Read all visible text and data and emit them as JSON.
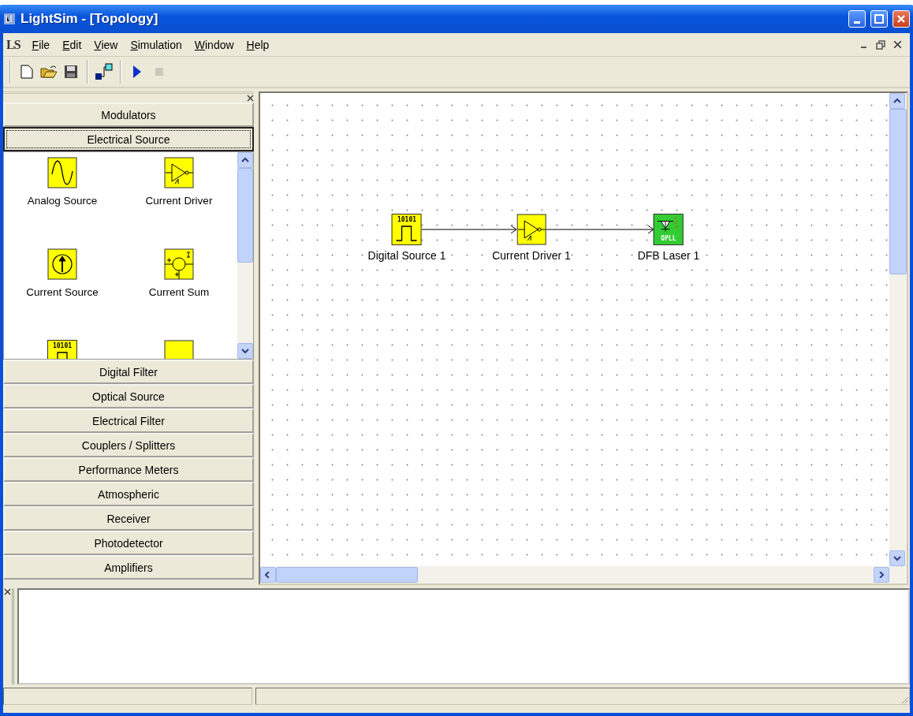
{
  "window": {
    "title": "LightSim - [Topology]"
  },
  "menu_bar": {
    "logo": "LS",
    "items": [
      "File",
      "Edit",
      "View",
      "Simulation",
      "Window",
      "Help"
    ]
  },
  "toolbar": {
    "groups": [
      [
        {
          "kind": "new",
          "disabled": false
        },
        {
          "kind": "open",
          "disabled": false
        },
        {
          "kind": "save",
          "disabled": false
        }
      ],
      [
        {
          "kind": "connect",
          "disabled": false
        }
      ],
      [
        {
          "kind": "run",
          "disabled": false
        },
        {
          "kind": "stop",
          "disabled": true
        }
      ]
    ]
  },
  "palette": {
    "categories": [
      {
        "label": "Modulators",
        "expanded": false
      },
      {
        "label": "Electrical Source",
        "expanded": true,
        "items": [
          {
            "label": "Analog Source",
            "kind": "sine"
          },
          {
            "label": "Current Driver",
            "kind": "driver"
          },
          {
            "label": "Current Source",
            "kind": "current-source"
          },
          {
            "label": "Current Sum",
            "kind": "current-sum"
          },
          {
            "kind": "digital",
            "caption": "10101"
          },
          {
            "kind": "generic"
          }
        ]
      },
      {
        "label": "Digital Filter",
        "expanded": false
      },
      {
        "label": "Optical Source",
        "expanded": false
      },
      {
        "label": "Electrical Filter",
        "expanded": false
      },
      {
        "label": "Couplers / Splitters",
        "expanded": false
      },
      {
        "label": "Performance Meters",
        "expanded": false
      },
      {
        "label": "Atmospheric",
        "expanded": false
      },
      {
        "label": "Receiver",
        "expanded": false
      },
      {
        "label": "Photodetector",
        "expanded": false
      },
      {
        "label": "Amplifiers",
        "expanded": false
      }
    ]
  },
  "diagram": {
    "nodes": [
      {
        "label": "Digital Source 1",
        "kind": "digital",
        "caption": "10101"
      },
      {
        "label": "Current Driver 1",
        "kind": "driver"
      },
      {
        "label": "DFB Laser 1",
        "kind": "laser",
        "caption": "OPLL"
      }
    ]
  }
}
